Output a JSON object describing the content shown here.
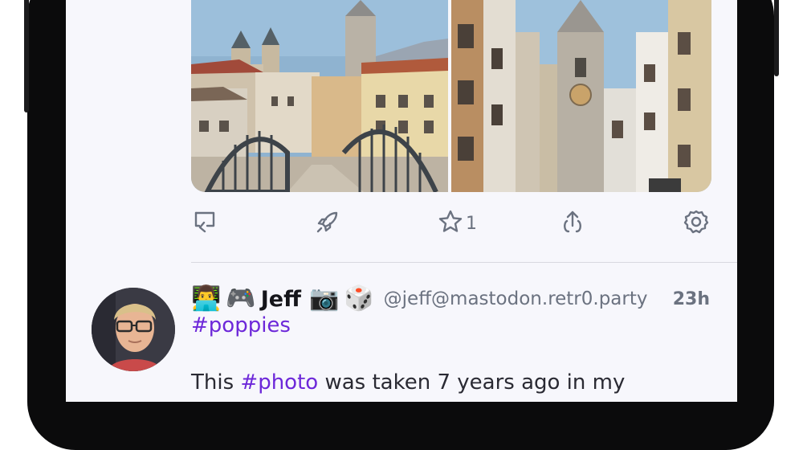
{
  "post_previous": {
    "actions": {
      "reply_icon": "reply-icon",
      "boost_icon": "boost-icon",
      "favourite_icon": "star-icon",
      "favourite_count": "1",
      "share_icon": "share-icon",
      "more_icon": "gear-icon"
    }
  },
  "post": {
    "emojis_before": [
      "👨‍💻",
      "🎮"
    ],
    "display_name": "Jeff",
    "emojis_after": [
      "📷",
      "🎲"
    ],
    "handle": "@jeff@mastodon.retr0.party",
    "time": "23h",
    "hashtag": "#poppies",
    "body_prefix": "This ",
    "body_tag": "#photo",
    "body_suffix": " was taken 7 years ago in my"
  },
  "colors": {
    "accent": "#6d28d9",
    "muted": "#6b7280",
    "screen_bg": "#f7f7fc"
  }
}
